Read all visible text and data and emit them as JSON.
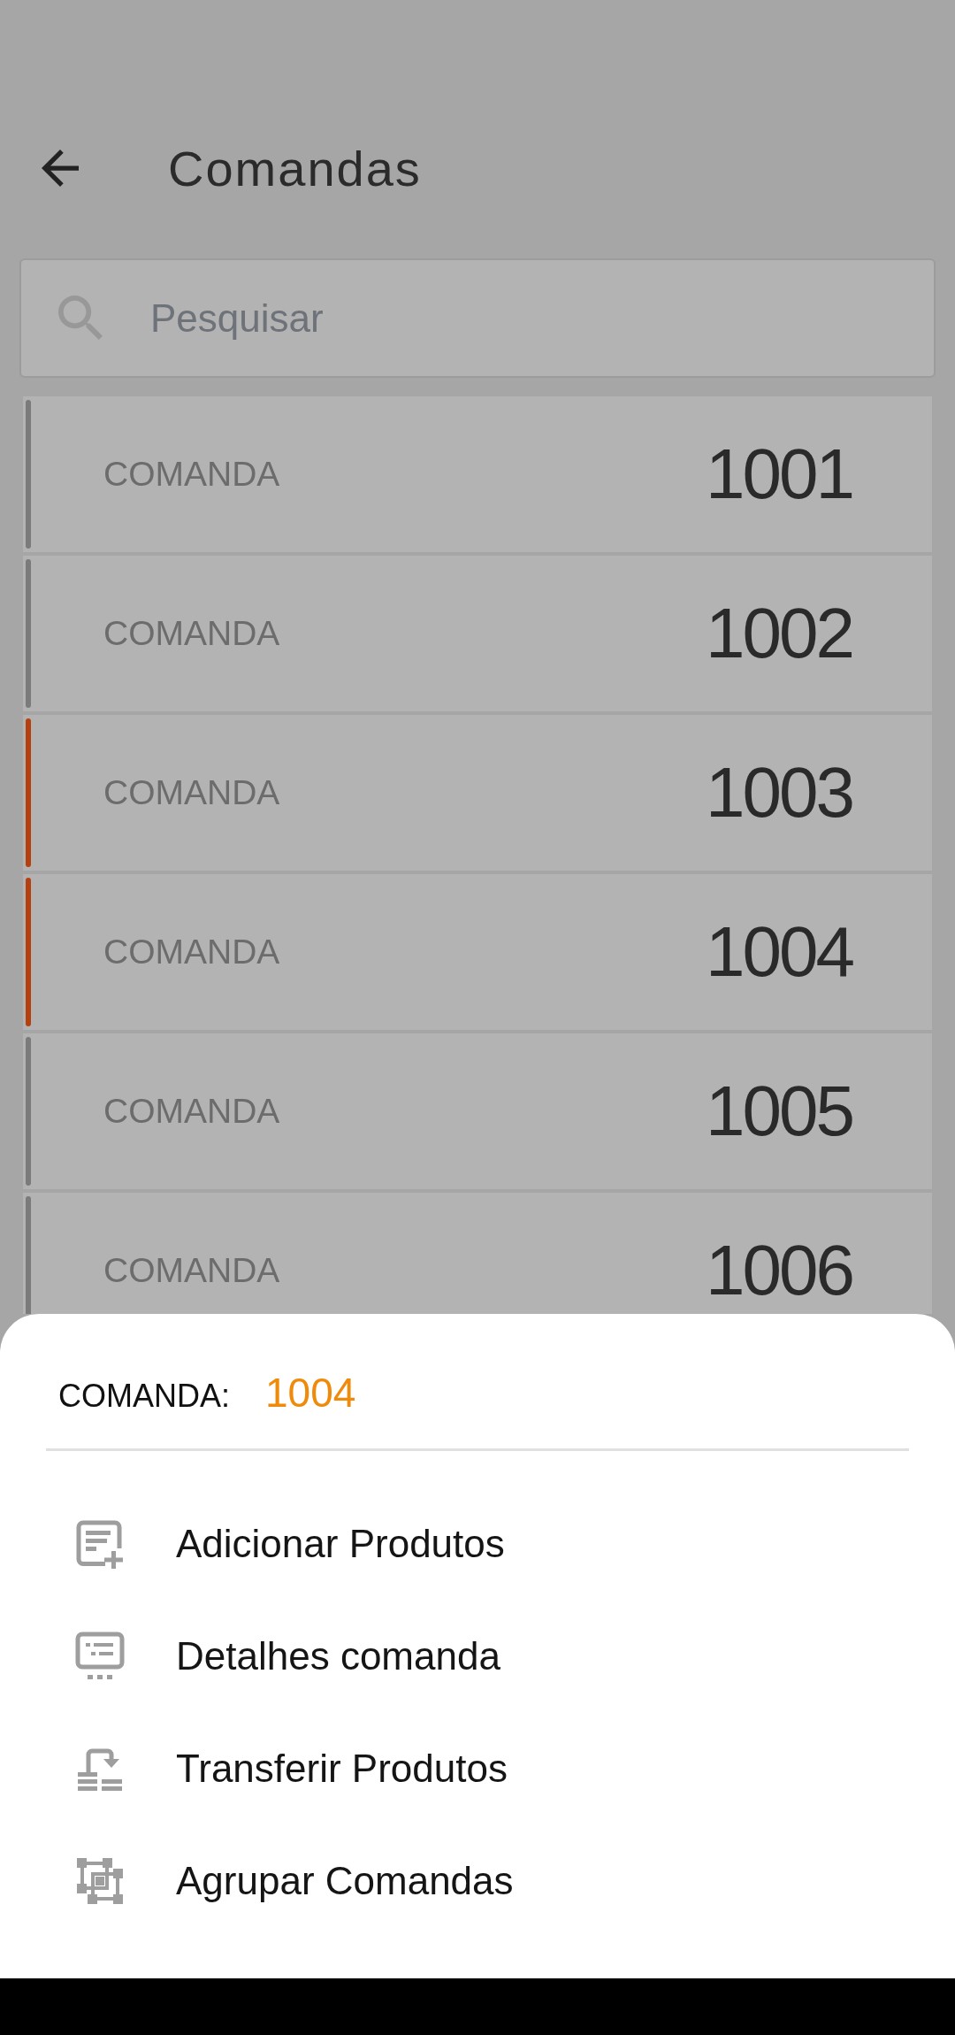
{
  "header": {
    "title": "Comandas"
  },
  "search": {
    "placeholder": "Pesquisar"
  },
  "rows": [
    {
      "label": "COMANDA",
      "number": "1001",
      "color": "#7b7b7b"
    },
    {
      "label": "COMANDA",
      "number": "1002",
      "color": "#7b7b7b"
    },
    {
      "label": "COMANDA",
      "number": "1003",
      "color": "#b3400e"
    },
    {
      "label": "COMANDA",
      "number": "1004",
      "color": "#b3400e"
    },
    {
      "label": "COMANDA",
      "number": "1005",
      "color": "#7b7b7b"
    },
    {
      "label": "COMANDA",
      "number": "1006",
      "color": "#7b7b7b"
    }
  ],
  "sheet": {
    "label": "COMANDA:",
    "value": "1004",
    "actions": [
      {
        "kind": "add",
        "label": "Adicionar Produtos"
      },
      {
        "kind": "details",
        "label": "Detalhes comanda"
      },
      {
        "kind": "transfer",
        "label": "Transferir Produtos"
      },
      {
        "kind": "group",
        "label": "Agrupar Comandas"
      }
    ]
  }
}
